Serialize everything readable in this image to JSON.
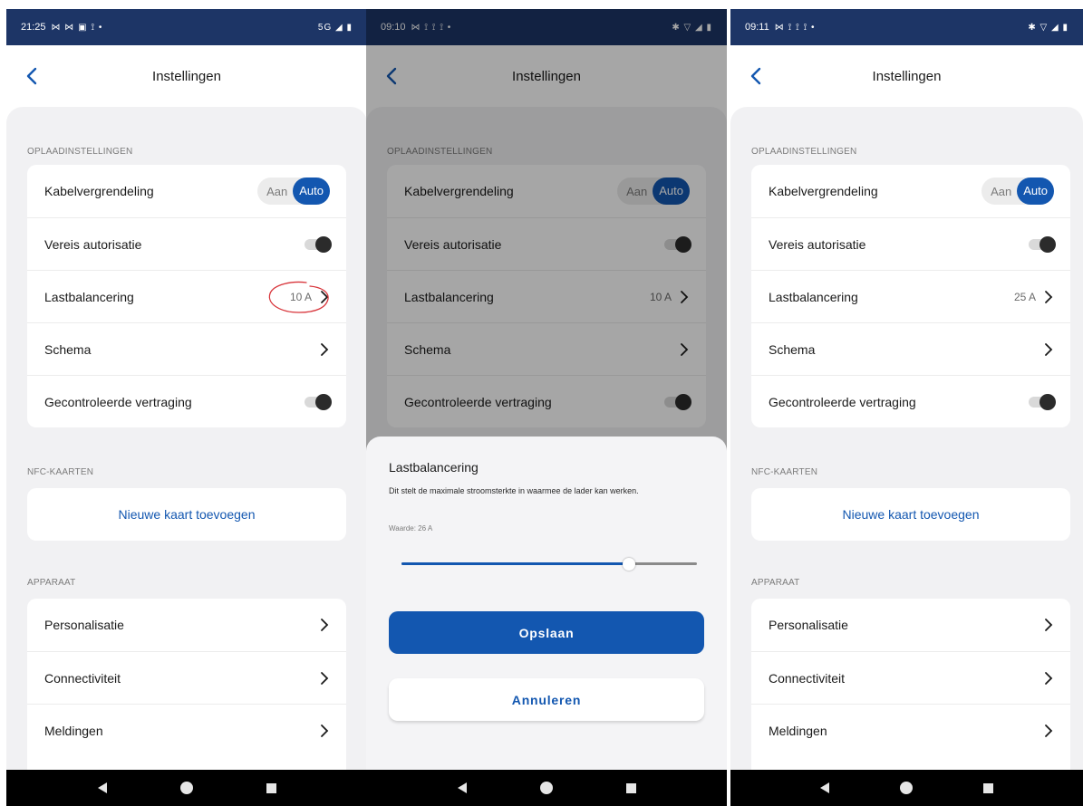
{
  "colors": {
    "accent": "#1357b0",
    "status_bar": "#1d3566",
    "background": "#f1f1f3",
    "annotation": "#d8343a"
  },
  "screens": [
    {
      "status": {
        "time": "21:25",
        "left_icons": "⋈ ⋈ ▣ ⟟ •",
        "right_icons": "5G ◢ ▮"
      },
      "header": {
        "title": "Instellingen",
        "back_icon": "chevron-left-icon"
      },
      "charging": {
        "header": "OPLAADINSTELLINGEN",
        "cable_lock": {
          "label": "Kabelvergrendeling",
          "option_off": "Aan",
          "option_on": "Auto"
        },
        "authorization": {
          "label": "Vereis autorisatie"
        },
        "load_balancing": {
          "label": "Lastbalancering",
          "value": "10 A"
        },
        "schedule": {
          "label": "Schema"
        },
        "delay": {
          "label": "Gecontroleerde vertraging"
        }
      },
      "nfc": {
        "header": "NFC-KAARTEN",
        "add_card": "Nieuwe kaart toevoegen"
      },
      "device": {
        "header": "APPARAAT",
        "items": [
          {
            "label": "Personalisatie"
          },
          {
            "label": "Connectiviteit"
          },
          {
            "label": "Meldingen"
          }
        ]
      }
    },
    {
      "status": {
        "time": "09:10",
        "left_icons": "⋈ ⟟ ⟟ ⟟ •",
        "right_icons": "✱ ▽ ◢ ▮"
      },
      "header": {
        "title": "Instellingen",
        "back_icon": "chevron-left-icon"
      },
      "charging": {
        "header": "OPLAADINSTELLINGEN",
        "cable_lock": {
          "label": "Kabelvergrendeling",
          "option_off": "Aan",
          "option_on": "Auto"
        },
        "authorization": {
          "label": "Vereis autorisatie"
        },
        "load_balancing": {
          "label": "Lastbalancering",
          "value": "10 A"
        },
        "schedule": {
          "label": "Schema"
        },
        "delay": {
          "label": "Gecontroleerde vertraging"
        }
      },
      "sheet": {
        "title": "Lastbalancering",
        "description": "Dit stelt de maximale stroomsterkte in waarmee de lader kan werken.",
        "value_text": "Waarde: 26 A",
        "slider_fraction": 0.77,
        "save_label": "Opslaan",
        "cancel_label": "Annuleren"
      }
    },
    {
      "status": {
        "time": "09:11",
        "left_icons": "⋈ ⟟ ⟟ ⟟ •",
        "right_icons": "✱ ▽ ◢ ▮"
      },
      "header": {
        "title": "Instellingen",
        "back_icon": "chevron-left-icon"
      },
      "charging": {
        "header": "OPLAADINSTELLINGEN",
        "cable_lock": {
          "label": "Kabelvergrendeling",
          "option_off": "Aan",
          "option_on": "Auto"
        },
        "authorization": {
          "label": "Vereis autorisatie"
        },
        "load_balancing": {
          "label": "Lastbalancering",
          "value": "25 A"
        },
        "schedule": {
          "label": "Schema"
        },
        "delay": {
          "label": "Gecontroleerde vertraging"
        }
      },
      "nfc": {
        "header": "NFC-KAARTEN",
        "add_card": "Nieuwe kaart toevoegen"
      },
      "device": {
        "header": "APPARAAT",
        "items": [
          {
            "label": "Personalisatie"
          },
          {
            "label": "Connectiviteit"
          },
          {
            "label": "Meldingen"
          }
        ]
      }
    }
  ]
}
